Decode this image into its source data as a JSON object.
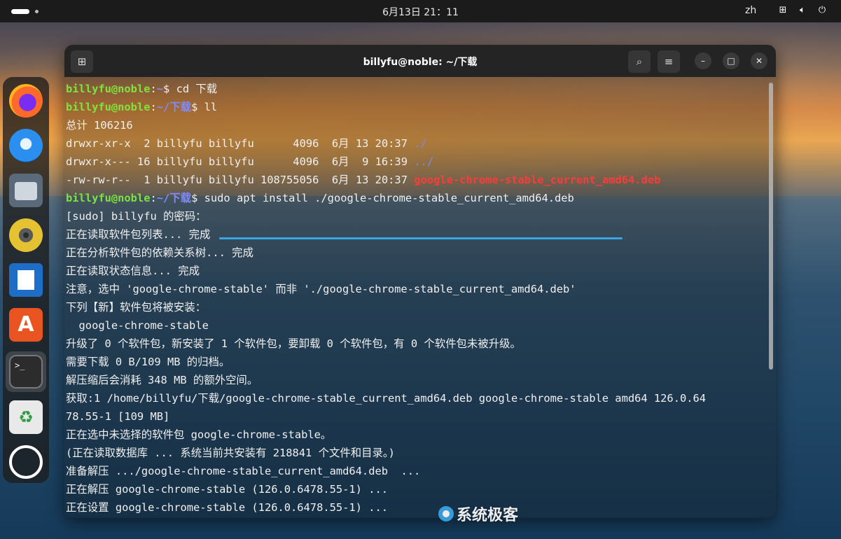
{
  "topbar": {
    "clock": "6月13日 21：11",
    "ime": "zh",
    "tray_icons": [
      "network-icon",
      "volume-icon",
      "power-icon"
    ]
  },
  "dock": {
    "apps": [
      "Firefox",
      "Thunderbird",
      "Files",
      "Rhythmbox",
      "LibreOffice Writer",
      "App Center",
      "Terminal",
      "Trash",
      "Show Apps"
    ],
    "terminal_glyph": ">_",
    "trash_glyph": "♻"
  },
  "window": {
    "title": "billyfu@noble: ~/下载"
  },
  "terminal": {
    "prompt_user": "billyfu@noble",
    "prompt_sep": ":",
    "home": "~",
    "dl_path": "~/下载",
    "sym": "$ ",
    "cmd1": "cd 下载",
    "cmd2": "ll",
    "total": "总计 106216",
    "ls1_meta": "drwxr-xr-x  2 billyfu billyfu      4096  6月 13 20:37 ",
    "ls1_name": "./",
    "ls2_meta": "drwxr-x--- 16 billyfu billyfu      4096  6月  9 16:39 ",
    "ls2_name": "../",
    "ls3_meta": "-rw-rw-r--  1 billyfu billyfu 108755056  6月 13 20:37 ",
    "ls3_name": "google-chrome-stable_current_amd64.deb",
    "cmd3": "sudo apt install ./google-chrome-stable_current_amd64.deb",
    "output": [
      "[sudo] billyfu 的密码：",
      "正在读取软件包列表... 完成",
      "正在分析软件包的依赖关系树... 完成",
      "正在读取状态信息... 完成",
      "注意，选中 'google-chrome-stable' 而非 './google-chrome-stable_current_amd64.deb'",
      "下列【新】软件包将被安装：",
      "  google-chrome-stable",
      "升级了 0 个软件包，新安装了 1 个软件包，要卸载 0 个软件包，有 0 个软件包未被升级。",
      "需要下载 0 B/109 MB 的归档。",
      "解压缩后会消耗 348 MB 的额外空间。",
      "获取:1 /home/billyfu/下载/google-chrome-stable_current_amd64.deb google-chrome-stable amd64 126.0.64",
      "78.55-1 [109 MB]",
      "正在选中未选择的软件包 google-chrome-stable。",
      "(正在读取数据库 ... 系统当前共安装有 218841 个文件和目录。)",
      "准备解压 .../google-chrome-stable_current_amd64.deb  ...",
      "正在解压 google-chrome-stable (126.0.6478.55-1) ...",
      "正在设置 google-chrome-stable (126.0.6478.55-1) ..."
    ]
  },
  "watermark": "系统极客",
  "colors": {
    "prompt_user": "#7ee33e",
    "prompt_path": "#7f8bff",
    "deb_file": "#ff3b3b",
    "highlight": "#3aa6e6"
  }
}
